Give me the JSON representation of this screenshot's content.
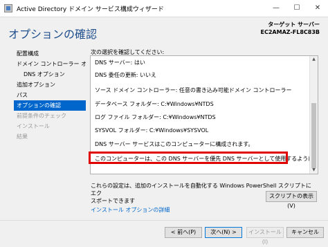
{
  "window": {
    "title": "Active Directory ドメイン サービス構成ウィザード",
    "minimize": "—",
    "maximize": "☐",
    "close": "✕"
  },
  "header": {
    "page_title": "オプションの確認",
    "target_label": "ターゲット サーバー",
    "target_value": "EC2AMAZ-FL8C83B"
  },
  "nav": {
    "items": [
      {
        "label": "配置構成",
        "state": "normal"
      },
      {
        "label": "ドメイン コントローラー オプシ...",
        "state": "normal"
      },
      {
        "label": "DNS オプション",
        "state": "sub"
      },
      {
        "label": "追加オプション",
        "state": "normal"
      },
      {
        "label": "パス",
        "state": "normal"
      },
      {
        "label": "オプションの確認",
        "state": "active"
      },
      {
        "label": "前提条件のチェック",
        "state": "disabled"
      },
      {
        "label": "インストール",
        "state": "disabled"
      },
      {
        "label": "結果",
        "state": "disabled"
      }
    ]
  },
  "content": {
    "label": "次の選択を確認してください:",
    "lines": [
      "DNS サーバー: はい",
      "DNS 委任の更新: いいえ",
      "ソース ドメイン コントローラー: 任意の書き込み可能ドメイン コントローラー",
      "データベース フォルダー: C:¥Windows¥NTDS",
      "ログ ファイル フォルダー: C:¥Windows¥NTDS",
      "SYSVOL フォルダー: C:¥Windows¥SYSVOL",
      "DNS サーバー サービスはこのコンピューターに構成されます。",
      "このコンピューターは、この DNS サーバーを優先 DNS サーバーとして使用するように構成されます。"
    ],
    "scroll_up": "▲",
    "scroll_down": "▼",
    "note_line1": "これらの設定は、追加のインストールを自動化する Windows PowerShell スクリプトにエク",
    "note_line2": "スポートできます",
    "script_button": "スクリプトの表示(V)",
    "details_link": "インストール オプションの詳細"
  },
  "footer": {
    "prev": "< 前へ(P)",
    "next": "次へ(N) >",
    "install": "インストール(I)",
    "cancel": "キャンセル"
  }
}
